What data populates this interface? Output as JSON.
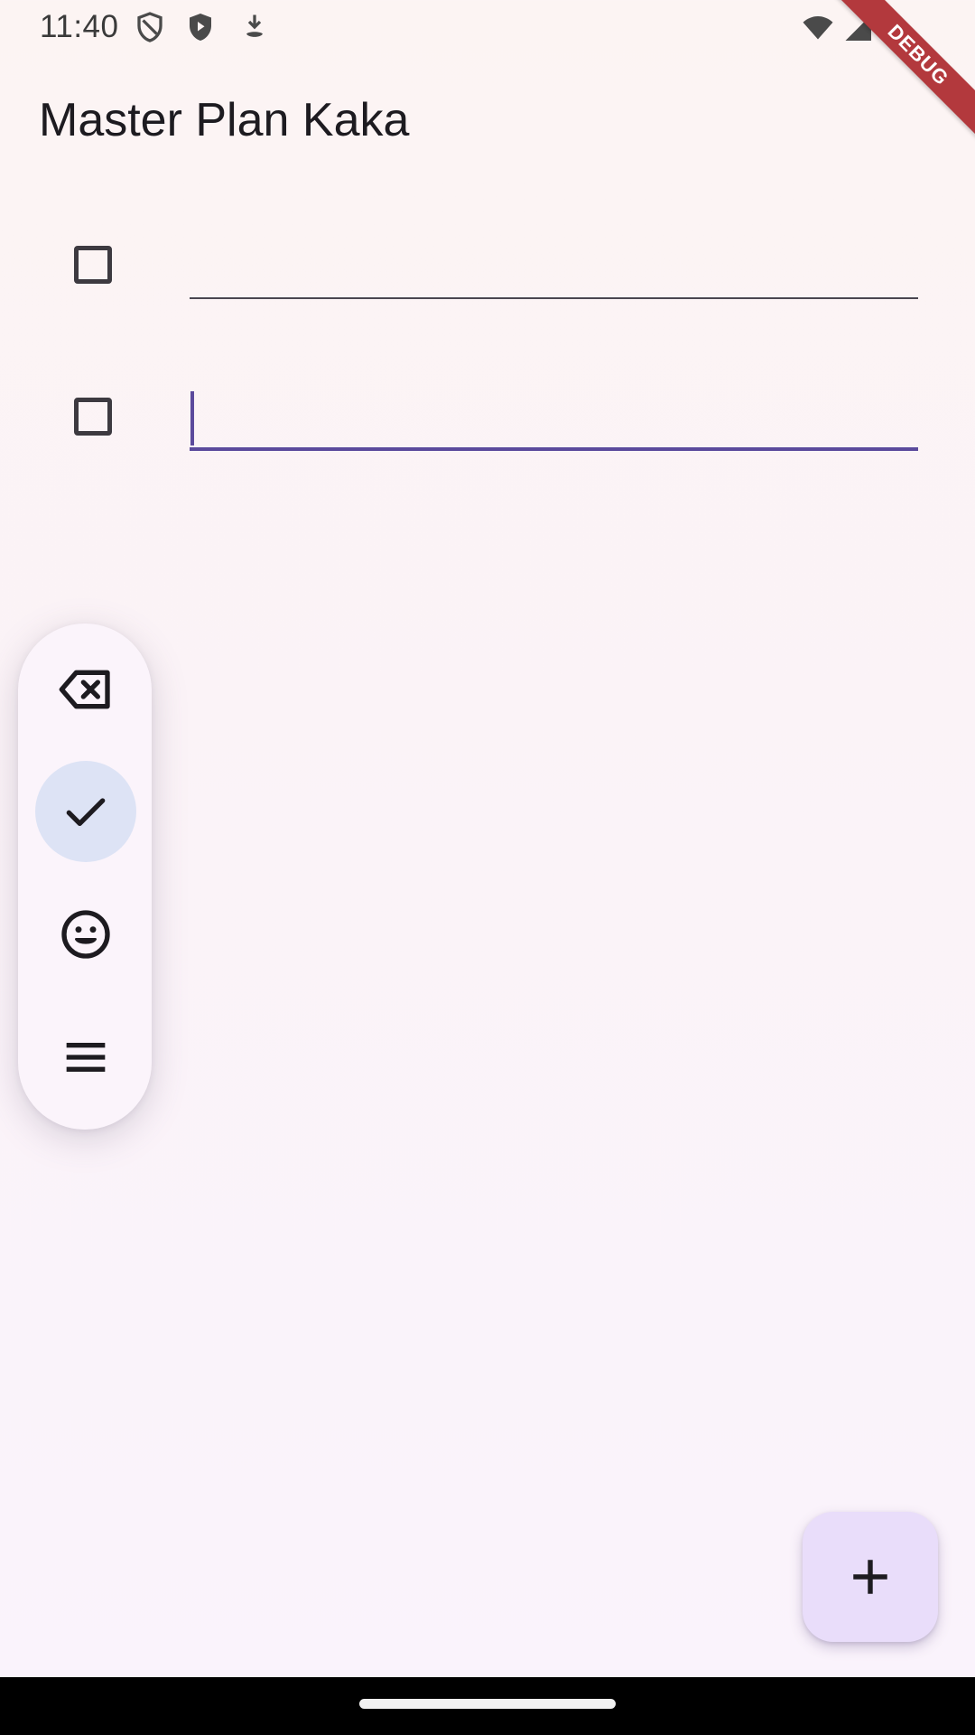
{
  "status_bar": {
    "time": "11:40",
    "icons": [
      "shield-outline-icon",
      "shield-play-icon",
      "download-arrow-icon",
      "wifi-icon",
      "signal-icon"
    ]
  },
  "debug_banner": {
    "label": "DEBUG",
    "color": "#b3393d"
  },
  "app_bar": {
    "title": "Master Plan Kaka"
  },
  "tasks": [
    {
      "checked": false,
      "value": "",
      "focused": false
    },
    {
      "checked": false,
      "value": "",
      "focused": true
    }
  ],
  "keyboard_toolbar": {
    "buttons": [
      {
        "icon": "backspace-icon",
        "active": false
      },
      {
        "icon": "check-icon",
        "active": true
      },
      {
        "icon": "emoji-icon",
        "active": false
      },
      {
        "icon": "menu-icon",
        "active": false
      }
    ]
  },
  "fab": {
    "icon": "add-icon",
    "color": "#e9ddfa"
  },
  "colors": {
    "accent": "#5b4a9c",
    "background": "#fbf3f7"
  }
}
